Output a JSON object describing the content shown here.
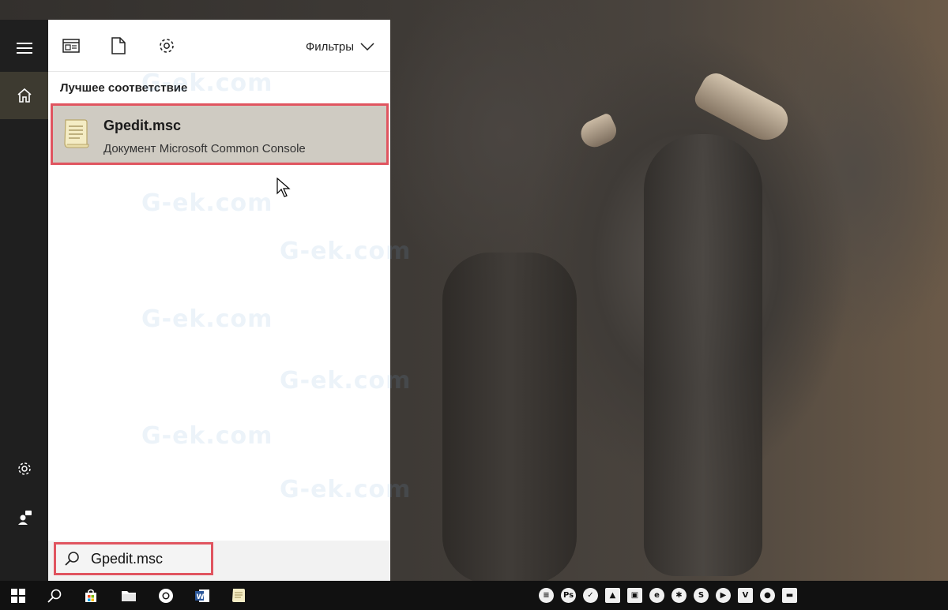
{
  "header": {
    "filters_label": "Фильтры"
  },
  "section": {
    "best_match_label": "Лучшее соответствие"
  },
  "result": {
    "title": "Gpedit.msc",
    "subtitle": "Документ Microsoft Common Console"
  },
  "search": {
    "value": "Gpedit.msc"
  },
  "watermark_text": "G-ek.com",
  "tray_icons": [
    "list-icon",
    "photoshop-icon",
    "vpn-icon",
    "photo-icon",
    "screenshot-icon",
    "edge-icon",
    "network-icon",
    "skype-icon",
    "media-icon",
    "vivaldi-icon",
    "chat-icon",
    "folder-icon"
  ]
}
